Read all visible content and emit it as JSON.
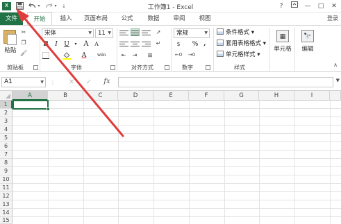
{
  "titlebar": {
    "logo_text": "X",
    "save_icon": "save-icon",
    "undo_icon": "undo-icon",
    "redo_icon": "redo-icon",
    "title": "工作簿1 - Excel",
    "help": "?",
    "restore_icon": "ribbon-display-icon",
    "minimize": "—",
    "maximize": "□",
    "close": "✕"
  },
  "tabs": [
    {
      "label": "文件"
    },
    {
      "label": "开始"
    },
    {
      "label": "插入"
    },
    {
      "label": "页面布局"
    },
    {
      "label": "公式"
    },
    {
      "label": "数据"
    },
    {
      "label": "审阅"
    },
    {
      "label": "视图"
    }
  ],
  "login": "登录",
  "ribbon": {
    "clipboard": {
      "paste": "粘贴",
      "group": "剪贴板"
    },
    "font": {
      "name": "宋体",
      "size": "11",
      "bold": "B",
      "italic": "I",
      "underline": "U",
      "grow": "A",
      "shrink": "A",
      "font_color": "A",
      "wen": "wén",
      "group": "字体"
    },
    "alignment": {
      "group": "对齐方式"
    },
    "number": {
      "format": "常规",
      "percent": "%",
      "comma": ",",
      "group": "数字"
    },
    "styles": {
      "conditional": "条件格式",
      "table": "套用表格格式",
      "cell": "单元格样式",
      "group": "样式"
    },
    "cells": {
      "label": "单元格"
    },
    "editing": {
      "label": "编辑"
    }
  },
  "formula_bar": {
    "name_box": "A1",
    "cancel": "✕",
    "enter": "✓",
    "fx": "fx",
    "value": ""
  },
  "sheet": {
    "columns": [
      "A",
      "B",
      "C",
      "D",
      "E",
      "F",
      "G",
      "H",
      "I"
    ],
    "rows": [
      "1",
      "2",
      "3",
      "4",
      "5",
      "6",
      "7",
      "8",
      "9",
      "10",
      "11",
      "12",
      "13",
      "14",
      "15"
    ],
    "active_cell": "A1"
  },
  "colors": {
    "accent": "#217346",
    "annotation_arrow": "#e03c3c"
  }
}
